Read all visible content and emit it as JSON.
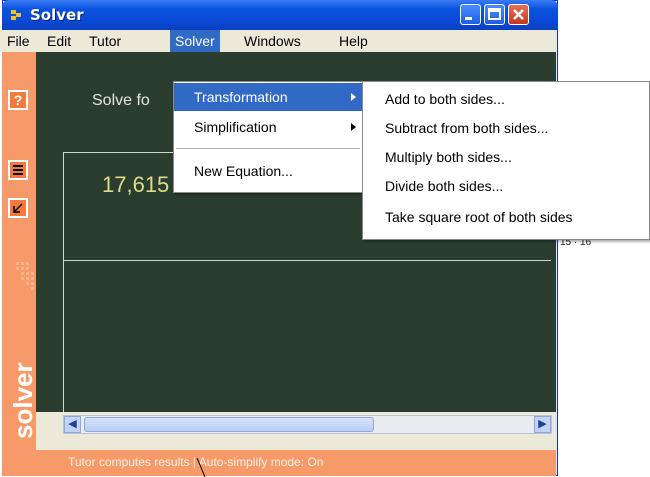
{
  "window": {
    "title": "Solver"
  },
  "menubar": {
    "items": [
      "File",
      "Edit",
      "Tutor",
      "Solver",
      "Windows",
      "Help"
    ]
  },
  "solver_menu": {
    "items": [
      "Transformation",
      "Simplification",
      "New Equation..."
    ]
  },
  "transformation_submenu": {
    "items": [
      "Add to both sides...",
      "Subtract from both sides...",
      "Multiply both sides...",
      "Divide both sides...",
      "Take square root of both sides"
    ]
  },
  "main": {
    "prompt": "Solve fo",
    "equation": "17,615",
    "bg_fragment": "15 · 16"
  },
  "sidebar": {
    "help_label": "?",
    "logo": "solver"
  },
  "status": {
    "text": "Tutor computes results  |  Auto-simplify mode: On"
  },
  "colors": {
    "accent": "#f79a6a",
    "workspace": "#2b3d2e",
    "highlight": "#316ac5",
    "title": "#0a53e0"
  }
}
